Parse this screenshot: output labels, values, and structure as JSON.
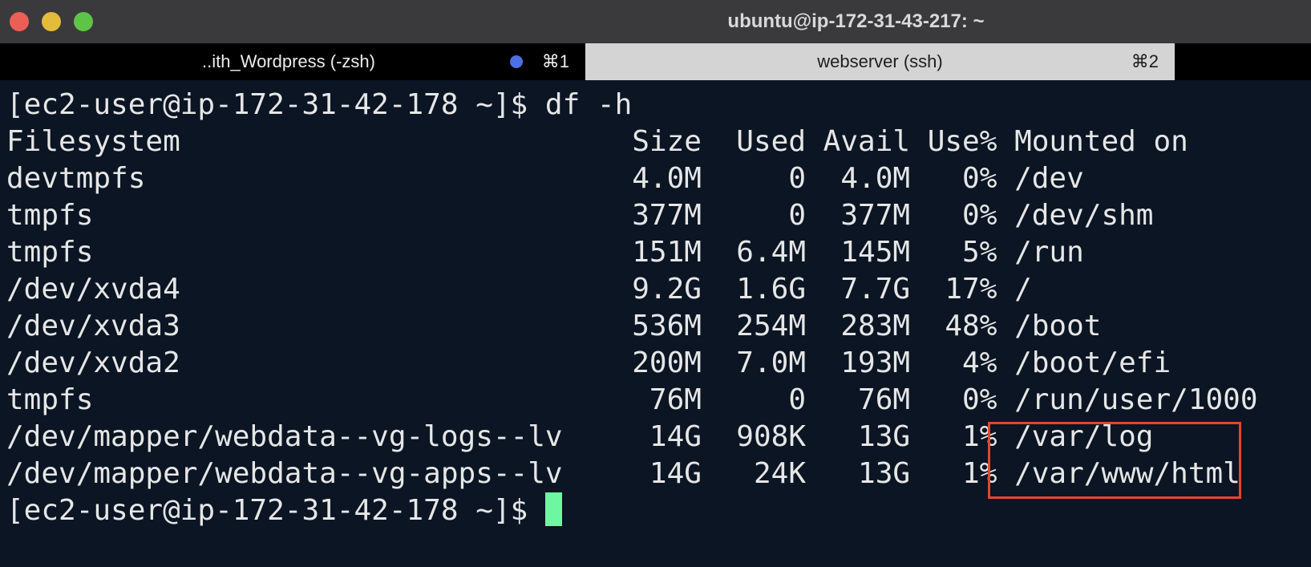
{
  "window": {
    "title": "ubuntu@ip-172-31-43-217: ~"
  },
  "tabs": [
    {
      "label": "..ith_Wordpress (-zsh)",
      "shortcut": "⌘1"
    },
    {
      "label": "webserver (ssh)",
      "shortcut": "⌘2"
    }
  ],
  "terminal": {
    "lines": [
      "[ec2-user@ip-172-31-42-178 ~]$ df -h",
      "Filesystem                          Size  Used Avail Use% Mounted on",
      "devtmpfs                            4.0M     0  4.0M   0% /dev",
      "tmpfs                               377M     0  377M   0% /dev/shm",
      "tmpfs                               151M  6.4M  145M   5% /run",
      "/dev/xvda4                          9.2G  1.6G  7.7G  17% /",
      "/dev/xvda3                          536M  254M  283M  48% /boot",
      "/dev/xvda2                          200M  7.0M  193M   4% /boot/efi",
      "tmpfs                                76M     0   76M   0% /run/user/1000",
      "/dev/mapper/webdata--vg-logs--lv     14G  908K   13G   1% /var/log",
      "/dev/mapper/webdata--vg-apps--lv     14G   24K   13G   1% /var/www/html"
    ],
    "prompt": "[ec2-user@ip-172-31-42-178 ~]$ "
  },
  "colors": {
    "background": "#0b1523",
    "cursor": "#6ef7a2",
    "highlight": "#e8452c"
  }
}
